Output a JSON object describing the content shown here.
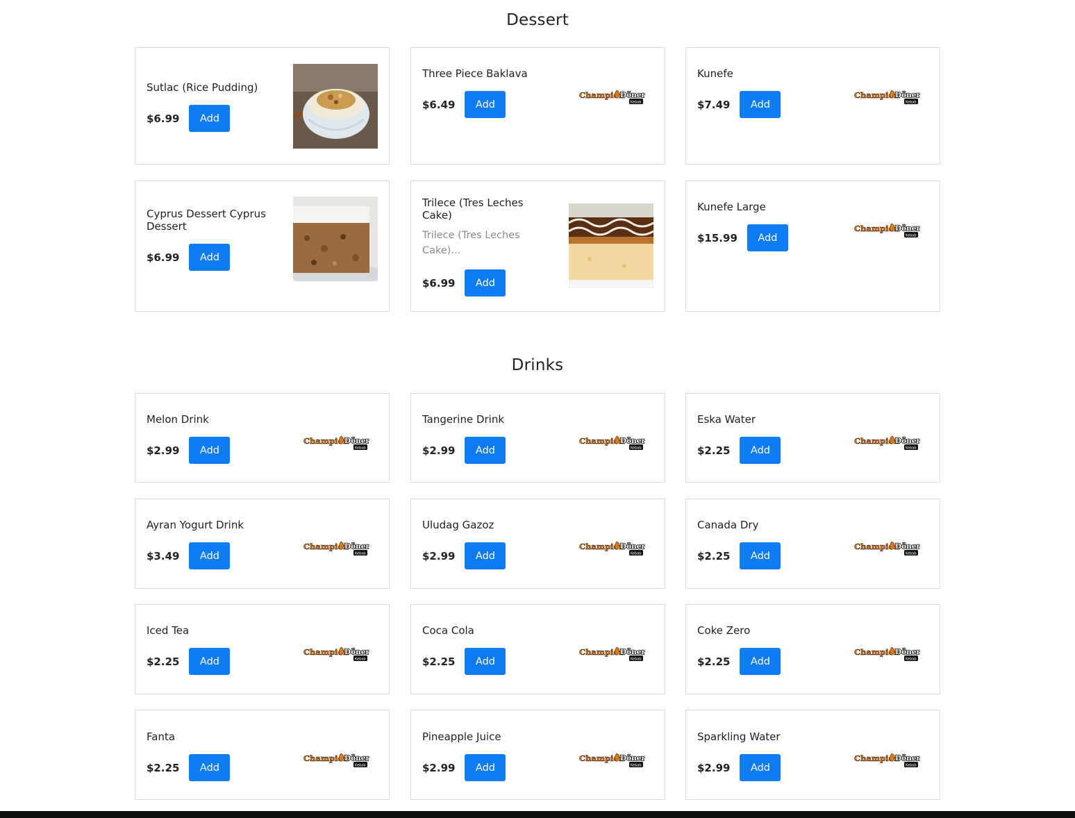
{
  "brand": {
    "logo_text": "Champion Döner",
    "logo_sub": "Kebab"
  },
  "sections": {
    "dessert": {
      "title": "Dessert",
      "items": [
        {
          "name": "Sutlac (Rice Pudding)",
          "price": "$6.99",
          "add_label": "Add",
          "image": "rice-pudding-photo"
        },
        {
          "name": "Three Piece Baklava",
          "price": "$6.49",
          "add_label": "Add",
          "image": "brand-logo"
        },
        {
          "name": "Kunefe",
          "price": "$7.49",
          "add_label": "Add",
          "image": "brand-logo"
        },
        {
          "name": "Cyprus Dessert Cyprus Dessert",
          "price": "$6.99",
          "add_label": "Add",
          "image": "cyprus-dessert-photo"
        },
        {
          "name": "Trilece (Tres Leches Cake)",
          "description": "Trilece (Tres Leches Cake)...",
          "price": "$6.99",
          "add_label": "Add",
          "image": "tres-leches-photo"
        },
        {
          "name": "Kunefe Large",
          "price": "$15.99",
          "add_label": "Add",
          "image": "brand-logo"
        }
      ]
    },
    "drinks": {
      "title": "Drinks",
      "items": [
        {
          "name": "Melon Drink",
          "price": "$2.99",
          "add_label": "Add"
        },
        {
          "name": "Tangerine Drink",
          "price": "$2.99",
          "add_label": "Add"
        },
        {
          "name": "Eska Water",
          "price": "$2.25",
          "add_label": "Add"
        },
        {
          "name": "Ayran Yogurt Drink",
          "price": "$3.49",
          "add_label": "Add"
        },
        {
          "name": "Uludag Gazoz",
          "price": "$2.99",
          "add_label": "Add"
        },
        {
          "name": "Canada Dry",
          "price": "$2.25",
          "add_label": "Add"
        },
        {
          "name": "Iced Tea",
          "price": "$2.25",
          "add_label": "Add"
        },
        {
          "name": "Coca Cola",
          "price": "$2.25",
          "add_label": "Add"
        },
        {
          "name": "Coke Zero",
          "price": "$2.25",
          "add_label": "Add"
        },
        {
          "name": "Fanta",
          "price": "$2.25",
          "add_label": "Add"
        },
        {
          "name": "Pineapple Juice",
          "price": "$2.99",
          "add_label": "Add"
        },
        {
          "name": "Sparkling Water",
          "price": "$2.99",
          "add_label": "Add"
        }
      ]
    }
  },
  "colors": {
    "button": "#0d7cf2",
    "border": "#dcdcdc",
    "logo_orange": "#e07a12"
  }
}
